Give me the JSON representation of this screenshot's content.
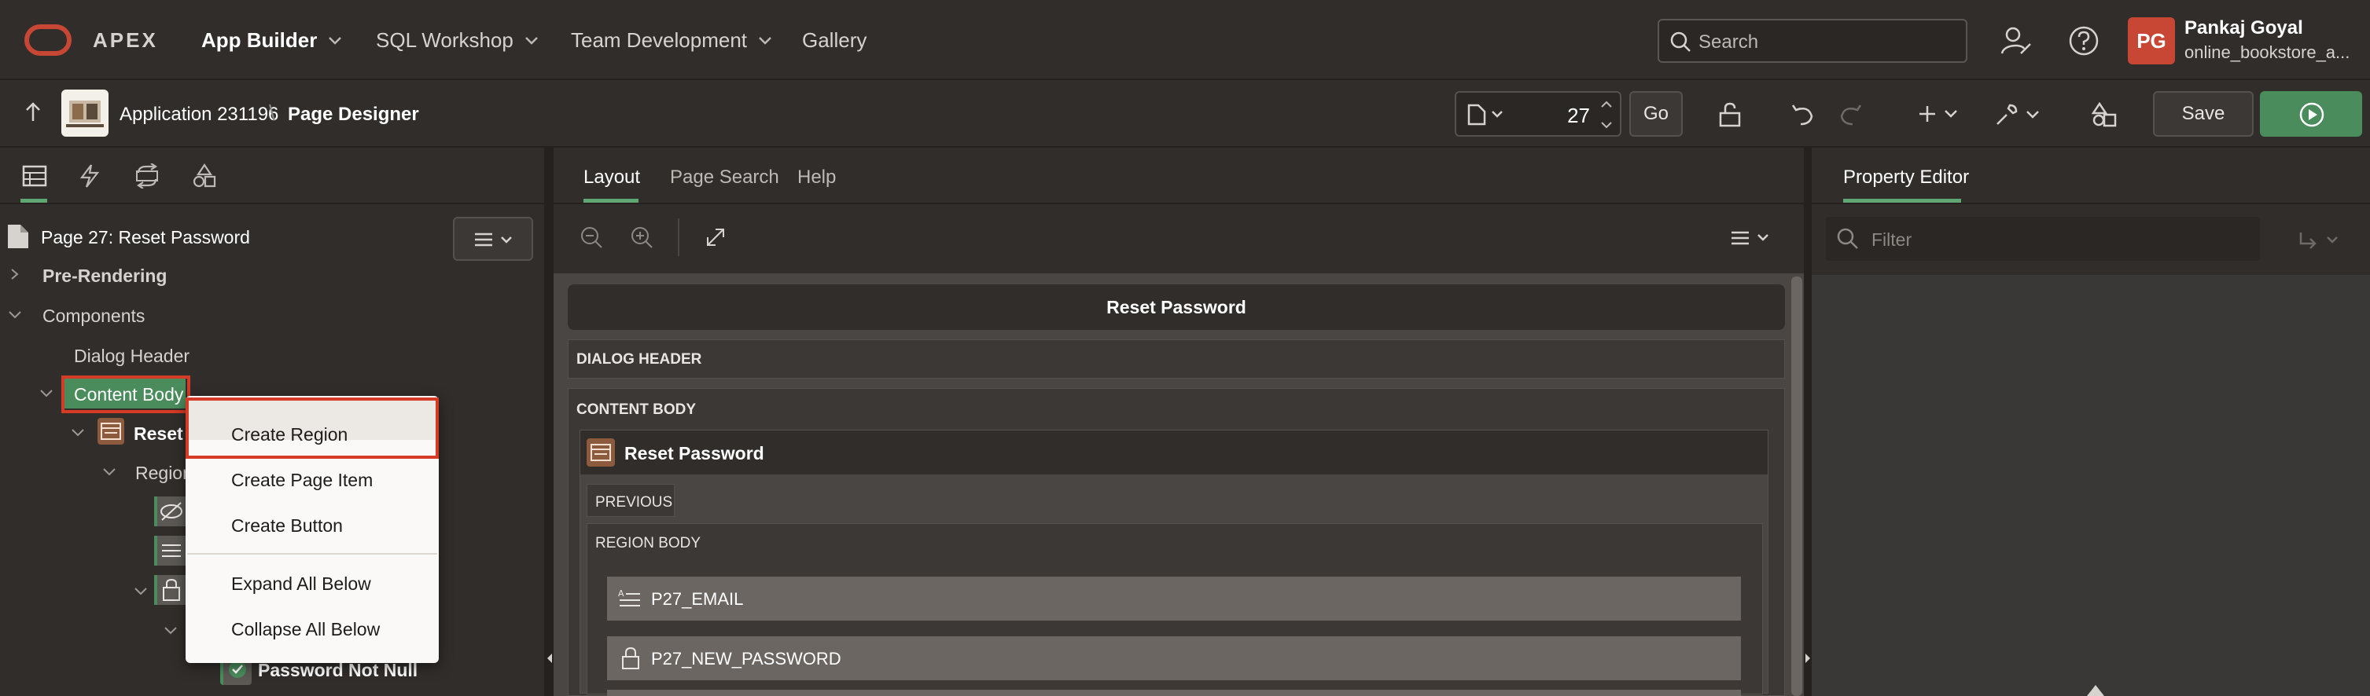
{
  "topnav": {
    "brand": "APEX",
    "menus": [
      {
        "label": "App Builder"
      },
      {
        "label": "SQL Workshop"
      },
      {
        "label": "Team Development"
      },
      {
        "label": "Gallery"
      }
    ],
    "search_placeholder": "Search",
    "user": {
      "initials": "PG",
      "name": "Pankaj Goyal",
      "workspace": "online_bookstore_a..."
    }
  },
  "toolbar": {
    "app_label": "Application 231196",
    "page_label": "Page Designer",
    "page_number": "27",
    "go_label": "Go",
    "save_label": "Save"
  },
  "left": {
    "page_title": "Page 27: Reset Password",
    "tree": {
      "pre_rendering": "Pre-Rendering",
      "components": "Components",
      "dialog_header": "Dialog Header",
      "content_body": "Content Body",
      "reset_region": "Reset P",
      "region_items": "Region",
      "password_not_null": "Password Not Null"
    }
  },
  "context_menu": {
    "items": [
      "Create Region",
      "Create Page Item",
      "Create Button",
      "Expand All Below",
      "Collapse All Below"
    ]
  },
  "center": {
    "tabs": [
      "Layout",
      "Page Search",
      "Help"
    ],
    "dialog_title": "Reset Password",
    "dialog_header": "DIALOG HEADER",
    "content_body": "CONTENT BODY",
    "region_title": "Reset Password",
    "previous": "PREVIOUS",
    "region_body": "REGION BODY",
    "items": [
      "P27_EMAIL",
      "P27_NEW_PASSWORD"
    ]
  },
  "right": {
    "tab": "Property Editor",
    "filter_placeholder": "Filter"
  },
  "colors": {
    "accent_green": "#4a8c5c",
    "highlight_red": "#d63b25",
    "avatar_red": "#c74634"
  }
}
